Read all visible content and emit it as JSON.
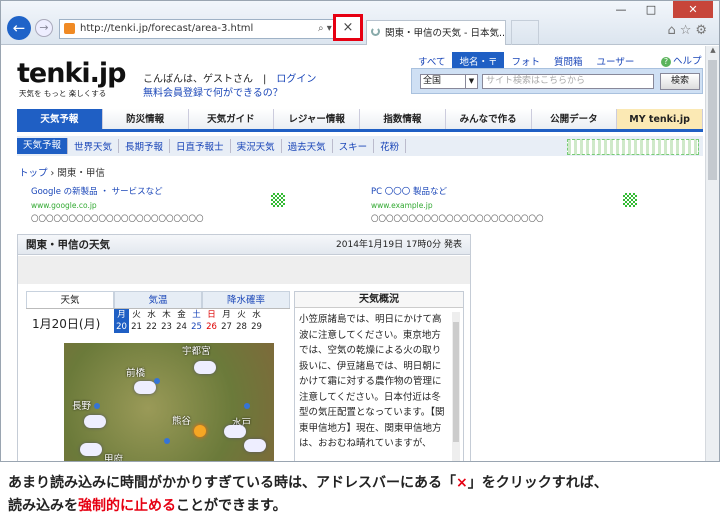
{
  "browser": {
    "url": "http://tenki.jp/forecast/area-3.html",
    "stop_glyph": "×",
    "tab_title": "関東・甲信の天気 - 日本気...",
    "tab_close": "×",
    "win": [
      "—",
      "□",
      "✕"
    ],
    "tools": "⌂☆⚙"
  },
  "site": {
    "logo": "tenki.jp",
    "tagline": "天気を もっと 楽しくする",
    "greeting": "こんばんは、ゲストさん",
    "login": "ログイン",
    "member": "無料会員登録で何ができるの？",
    "search_tabs": [
      "すべて",
      "地名・〒",
      "フォト",
      "質問箱",
      "ユーザー"
    ],
    "search_tab_active": "地名・〒",
    "help": "ヘルプ",
    "region_select": "全国",
    "search_placeholder": "サイト検索はこちらから",
    "search_button": "検索",
    "nav": [
      "天気予報",
      "防災情報",
      "天気ガイド",
      "レジャー情報",
      "指数情報",
      "みんなで作る",
      "公開データ",
      "MY tenki.jp"
    ],
    "subnav": [
      "天気予報",
      "世界天気",
      "長期予報",
      "日直予報士",
      "実況天気",
      "過去天気",
      "スキー",
      "花粉"
    ],
    "breadcrumb": {
      "top": "トップ",
      "current": "関東・甲信"
    },
    "ads": [
      {
        "title": "Google の新製品 ・ サービスなど",
        "url": "www.google.co.jp",
        "desc": "〇〇〇〇〇〇〇〇〇〇〇〇〇〇〇〇〇〇〇〇〇〇〇"
      },
      {
        "title": "PC 〇〇〇 製品など",
        "url": "www.example.jp",
        "desc": "〇〇〇〇〇〇〇〇〇〇〇〇〇〇〇〇〇〇〇〇〇〇〇"
      }
    ],
    "panel": {
      "title": "関東・甲信の天気",
      "date": "2014年1月19日 17時0分 発表",
      "tabs": [
        "天気",
        "気温",
        "降水確率"
      ],
      "day": "1月20日(月)",
      "cal_days": [
        {
          "w": "月",
          "d": "20"
        },
        {
          "w": "火",
          "d": "21"
        },
        {
          "w": "水",
          "d": "22"
        },
        {
          "w": "木",
          "d": "23"
        },
        {
          "w": "金",
          "d": "24"
        },
        {
          "w": "土",
          "d": "25"
        },
        {
          "w": "日",
          "d": "26"
        },
        {
          "w": "月",
          "d": "27"
        },
        {
          "w": "火",
          "d": "28"
        },
        {
          "w": "水",
          "d": "29"
        }
      ],
      "places": [
        "宇都宮",
        "前橋",
        "長野",
        "熊谷",
        "水戸",
        "甲府"
      ],
      "overview_title": "天気概況",
      "overview": "小笠原諸島では、明日にかけて高波に注意してください。東京地方では、空気の乾燥による火の取り扱いに、伊豆諸島では、明日朝にかけて霜に対する農作物の管理に注意してください。日本付近は冬型の気圧配置となっています。【関東甲信地方】現在、関東甲信地方は、おおむね晴れていますが、"
    }
  },
  "caption": {
    "line1_a": "あまり読み込みに時間がかかりすぎている時は、アドレスバーにある「",
    "line1_x": "×",
    "line1_b": "」をクリックすれば、",
    "line2_a": "読み込みを",
    "line2_red": "強制的に止める",
    "line2_b": "ことができます。"
  }
}
